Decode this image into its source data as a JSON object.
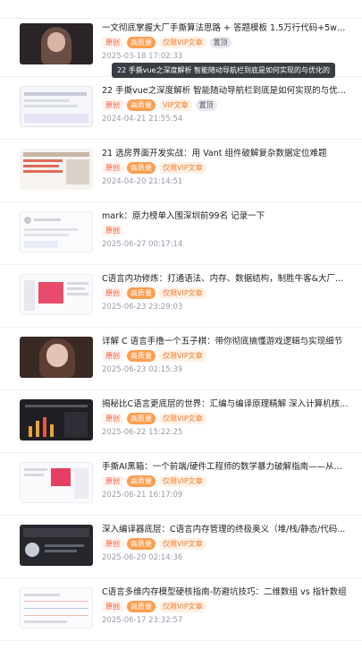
{
  "tooltip": {
    "text": "22 手撕vue之深度解析 智能随动导航栏到底是如何实现的与优化的"
  },
  "items": [
    {
      "title": "一文彻底掌握大厂手撕算法思路 + 答题模板 1.5万行代码+5w字...",
      "tags": [
        "原创",
        "高质量",
        "仅限VIP文章",
        "置顶"
      ],
      "date": "2025-03-18 17:02:33",
      "thumb": "portrait-dark"
    },
    {
      "title": "22 手撕vue之深度解析 智能随动导航栏到底是如何实现的与优化的",
      "tags": [
        "原创",
        "高质量",
        "VIP文章",
        "置顶"
      ],
      "date": "2024-04-21 21:55:54",
      "thumb": "screenshot-light"
    },
    {
      "title": "21 选房界面开发实战：用 Vant 组件破解复杂数据定位难题",
      "tags": [
        "原创",
        "高质量",
        "仅限VIP文章"
      ],
      "date": "2024-04-20 21:14:51",
      "thumb": "screenshot-red"
    },
    {
      "title": "mark：原力榜单入围深圳前99名 记录一下",
      "tags": [
        "原创"
      ],
      "date": "2025-06-27 00:17:14",
      "thumb": "screenshot-white"
    },
    {
      "title": "C语言内功修炼：打通语法、内存、数据结构，制胜牛客&大厂...",
      "tags": [
        "原创",
        "高质量",
        "仅限VIP文章"
      ],
      "date": "2025-06-23 23:29:03",
      "thumb": "screenshot-pink"
    },
    {
      "title": "详解 C 语言手撸一个五子棋：带你彻底搞懂游戏逻辑与实现细节",
      "tags": [
        "原创",
        "高质量",
        "仅限VIP文章"
      ],
      "date": "2025-06-23 02:15:39",
      "thumb": "portrait-dark"
    },
    {
      "title": "揭秘比C语言更底层的世界：汇编与编译原理精解 深入计算机核...",
      "tags": [
        "原创",
        "高质量",
        "仅限VIP文章"
      ],
      "date": "2025-06-22 15:22:25",
      "thumb": "screenshot-dark"
    },
    {
      "title": "手撕AI黑箱：一个前端/硬件工程师的数学暴力破解指南——从神...",
      "tags": [
        "原创",
        "高质量",
        "仅限VIP文章"
      ],
      "date": "2025-06-21 16:17:09",
      "thumb": "screenshot-pink2"
    },
    {
      "title": "深入编译器底层：C语言内存管理的终极奥义（堆/栈/静态/代码...",
      "tags": [
        "原创",
        "高质量",
        "仅限VIP文章"
      ],
      "date": "2025-06-20 02:14:36",
      "thumb": "screenshot-dark2"
    },
    {
      "title": "C语言多维内存模型硬核指南-防避坑技巧：二维数组 vs 指针数组",
      "tags": [
        "原创",
        "高质量",
        "仅限VIP文章"
      ],
      "date": "2025-06-17 23:32:57",
      "thumb": "screenshot-chart"
    }
  ]
}
